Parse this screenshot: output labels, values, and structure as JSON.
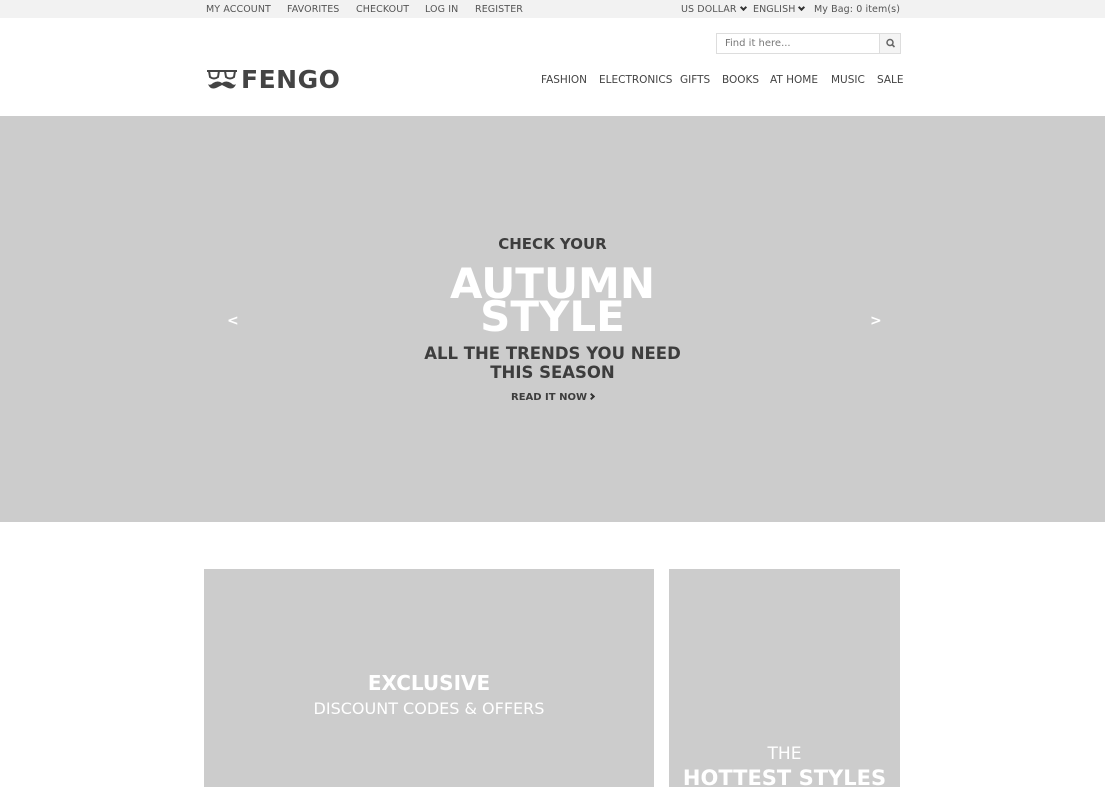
{
  "topbar": {
    "my_account": "My Account",
    "favorites": "Favorites",
    "checkout": "Checkout",
    "log_in": "Log In",
    "register": "Register",
    "currency": "US Dollar",
    "language": "English",
    "bag": "My Bag: 0 item(s)"
  },
  "search": {
    "placeholder": "Find it here..."
  },
  "brand": {
    "name": "FENGO",
    "logo_icon": "glasses-mustache-icon"
  },
  "nav": [
    "Fashion",
    "Electronics",
    "Gifts",
    "Books",
    "At Home",
    "Music",
    "Sale"
  ],
  "hero": {
    "pre_title": "CHECK YOUR",
    "title_line1": "AUTUMN",
    "title_line2": "STYLE",
    "subtitle_line1": "ALL THE TRENDS YOU NEED",
    "subtitle_line2": "THIS SEASON",
    "cta": "Read it now",
    "prev": "<",
    "next": ">"
  },
  "promo_left": {
    "title": "EXCLUSIVE",
    "subtitle": "DISCOUNT CODES & OFFERS"
  },
  "promo_right": {
    "title_small": "THE",
    "title_big": "HOTTEST STYLES"
  },
  "colors": {
    "placeholder_gray": "#cccccc",
    "topbar_bg": "#f2f2f2",
    "text_dark": "#444444"
  }
}
